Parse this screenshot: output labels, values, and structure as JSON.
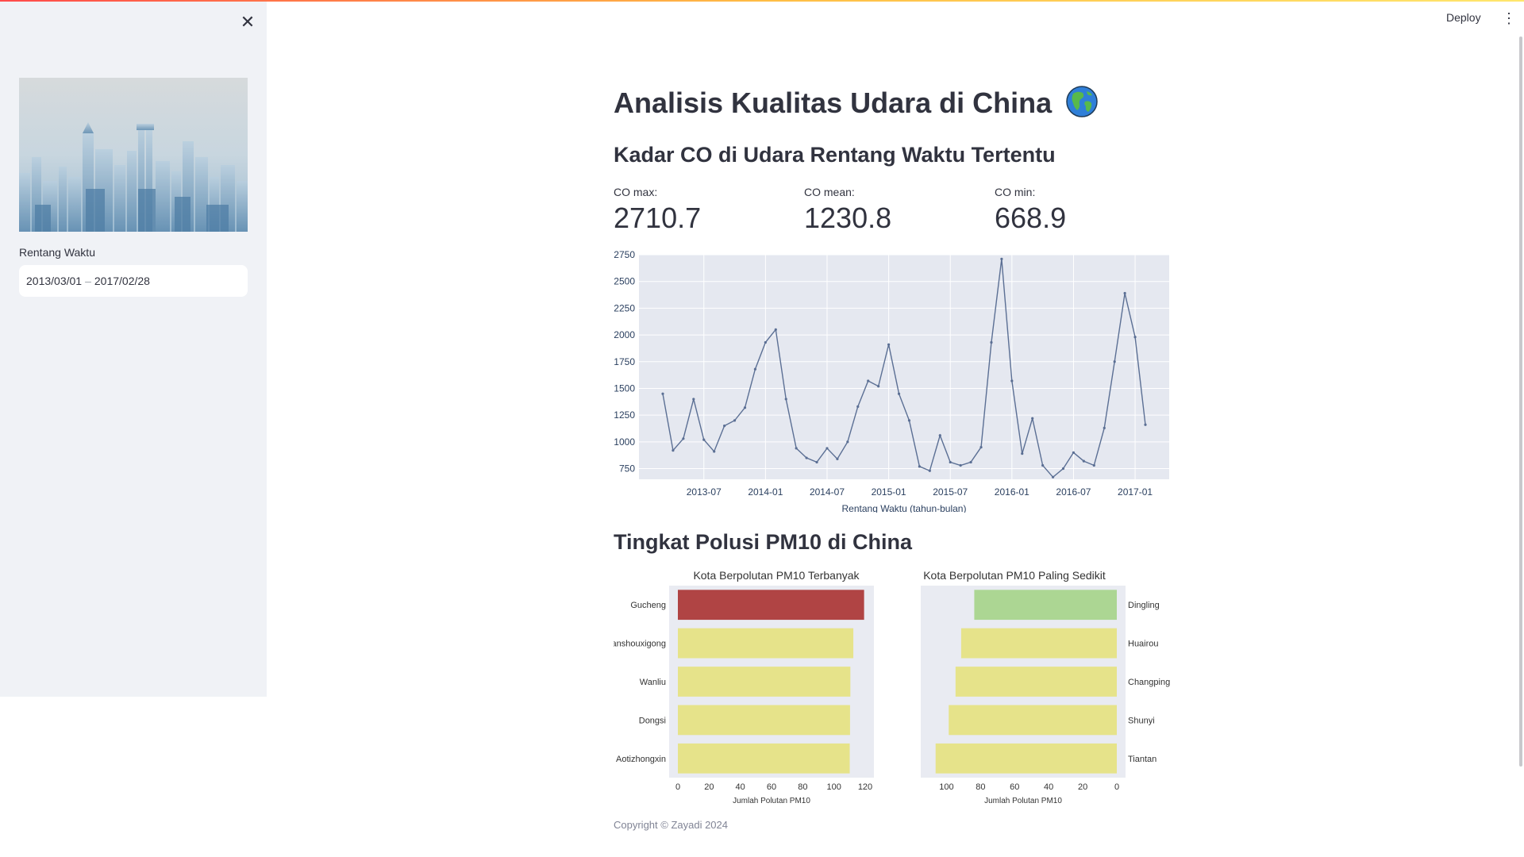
{
  "app": {
    "deploy_label": "Deploy",
    "close_icon": "close-icon",
    "menu_icon": "more-vertical-icon"
  },
  "sidebar": {
    "date_label": "Rentang Waktu",
    "date_start": "2013/03/01",
    "date_sep": "–",
    "date_end": "2017/02/28"
  },
  "main": {
    "title": "Analisis Kualitas Udara di China",
    "title_icon": "globe-icon",
    "co_heading": "Kadar CO di Udara Rentang Waktu Tertentu",
    "metrics": [
      {
        "label": "CO max:",
        "value": "2710.7"
      },
      {
        "label": "CO mean:",
        "value": "1230.8"
      },
      {
        "label": "CO min:",
        "value": "668.9"
      }
    ],
    "pm10_heading": "Tingkat Polusi PM10 di China",
    "footer": "Copyright © Zayadi 2024"
  },
  "chart_data": [
    {
      "type": "line",
      "xlabel": "Rentang Waktu (tahun-bulan)",
      "ylabel": "",
      "ylim": [
        650,
        2750
      ],
      "yticks": [
        750,
        1000,
        1250,
        1500,
        1750,
        2000,
        2250,
        2500,
        2750
      ],
      "xticks": [
        "2013-07",
        "2014-01",
        "2014-07",
        "2015-01",
        "2015-07",
        "2016-01",
        "2016-07",
        "2017-01"
      ],
      "x": [
        "2013-03",
        "2013-04",
        "2013-05",
        "2013-06",
        "2013-07",
        "2013-08",
        "2013-09",
        "2013-10",
        "2013-11",
        "2013-12",
        "2014-01",
        "2014-02",
        "2014-03",
        "2014-04",
        "2014-05",
        "2014-06",
        "2014-07",
        "2014-08",
        "2014-09",
        "2014-10",
        "2014-11",
        "2014-12",
        "2015-01",
        "2015-02",
        "2015-03",
        "2015-04",
        "2015-05",
        "2015-06",
        "2015-07",
        "2015-08",
        "2015-09",
        "2015-10",
        "2015-11",
        "2015-12",
        "2016-01",
        "2016-02",
        "2016-03",
        "2016-04",
        "2016-05",
        "2016-06",
        "2016-07",
        "2016-08",
        "2016-09",
        "2016-10",
        "2016-11",
        "2016-12",
        "2017-01",
        "2017-02"
      ],
      "values": [
        1450,
        920,
        1030,
        1400,
        1020,
        910,
        1150,
        1200,
        1320,
        1680,
        1930,
        2050,
        1400,
        940,
        850,
        810,
        940,
        840,
        1000,
        1330,
        1570,
        1520,
        1910,
        1450,
        1200,
        770,
        730,
        1060,
        810,
        780,
        810,
        950,
        1930,
        2710,
        1570,
        890,
        1220,
        780,
        670,
        750,
        900,
        820,
        780,
        1130,
        1750,
        2390,
        1980,
        1160
      ],
      "grid": true
    },
    {
      "type": "bar",
      "orientation": "horizontal",
      "title": "Kota Berpolutan PM10 Terbanyak",
      "xlabel": "Jumlah Polutan PM10",
      "xlim": [
        0,
        120
      ],
      "xticks": [
        0,
        20,
        40,
        60,
        80,
        100,
        120
      ],
      "categories": [
        "Gucheng",
        "Wanshouxigong",
        "Wanliu",
        "Dongsi",
        "Aotizhongxin"
      ],
      "values": [
        119.3,
        112.4,
        110.5,
        110.3,
        110.1
      ],
      "colors": [
        "#b04444",
        "#e6e38a",
        "#e6e38a",
        "#e6e38a",
        "#e6e38a"
      ]
    },
    {
      "type": "bar",
      "orientation": "horizontal",
      "title": "Kota Berpolutan PM10 Paling Sedikit",
      "xlabel": "Jumlah Polutan PM10",
      "xlim": [
        110,
        0
      ],
      "xticks": [
        100,
        80,
        60,
        40,
        20,
        0
      ],
      "axis_reversed": true,
      "categories": [
        "Dingling",
        "Huairou",
        "Changping",
        "Shunyi",
        "Tiantan"
      ],
      "values": [
        83.7,
        91.4,
        94.7,
        98.7,
        106.4
      ],
      "colors": [
        "#acd693",
        "#e6e38a",
        "#e6e38a",
        "#e6e38a",
        "#e6e38a"
      ]
    }
  ]
}
